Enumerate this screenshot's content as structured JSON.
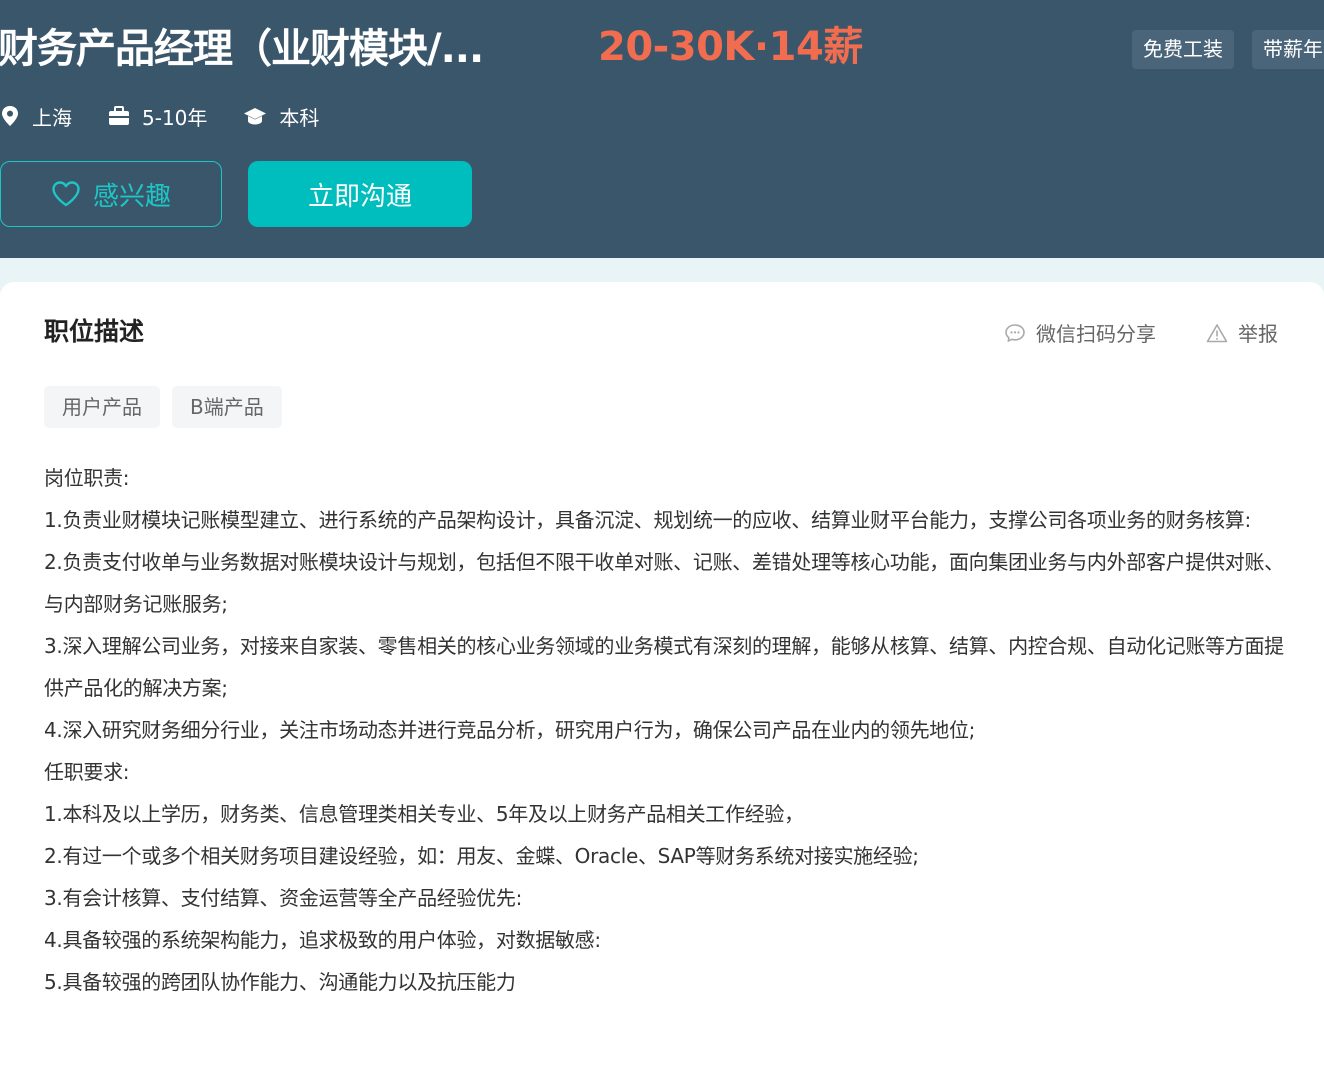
{
  "header": {
    "job_title": "财务产品经理（业财模块/...",
    "salary": "20-30K·14薪",
    "welfare_tags": [
      "免费工装",
      "带薪年"
    ],
    "meta": {
      "location": "上海",
      "experience": "5-10年",
      "education": "本科"
    },
    "buttons": {
      "interest": "感兴趣",
      "chat": "立即沟通"
    }
  },
  "card": {
    "section_title": "职位描述",
    "actions": {
      "share": "微信扫码分享",
      "report": "举报"
    },
    "skill_tags": [
      "用户产品",
      "B端产品"
    ],
    "description_lines": [
      "岗位职责:",
      "1.负责业财模块记账模型建立、进行系统的产品架构设计，具备沉淀、规划统一的应收、结算业财平台能力，支撑公司各项业务的财务核算:",
      "2.负责支付收单与业务数据对账模块设计与规划，包括但不限干收单对账、记账、差错处理等核心功能，面向集团业务与内外部客户提供对账、与内部财务记账服务;",
      "3.深入理解公司业务，对接来自家装、零售相关的核心业务领域的业务模式有深刻的理解，能够从核算、结算、内控合规、自动化记账等方面提供产品化的解决方案;",
      "4.深入研究财务细分行业，关注市场动态并进行竞品分析，研究用户行为，确保公司产品在业内的领先地位;",
      "任职要求:",
      "1.本科及以上学历，财务类、信息管理类相关专业、5年及以上财务产品相关工作经验，",
      "2.有过一个或多个相关财务项目建设经验，如：用友、金蝶、Oracle、SAP等财务系统对接实施经验;",
      "3.有会计核算、支付结算、资金运营等全产品经验优先:",
      "4.具备较强的系统架构能力，追求极致的用户体验，对数据敏感:",
      "5.具备较强的跨团队协作能力、沟通能力以及抗压能力"
    ]
  },
  "colors": {
    "header_bg": "#3a566b",
    "salary": "#f26d4f",
    "accent": "#00bebd"
  }
}
